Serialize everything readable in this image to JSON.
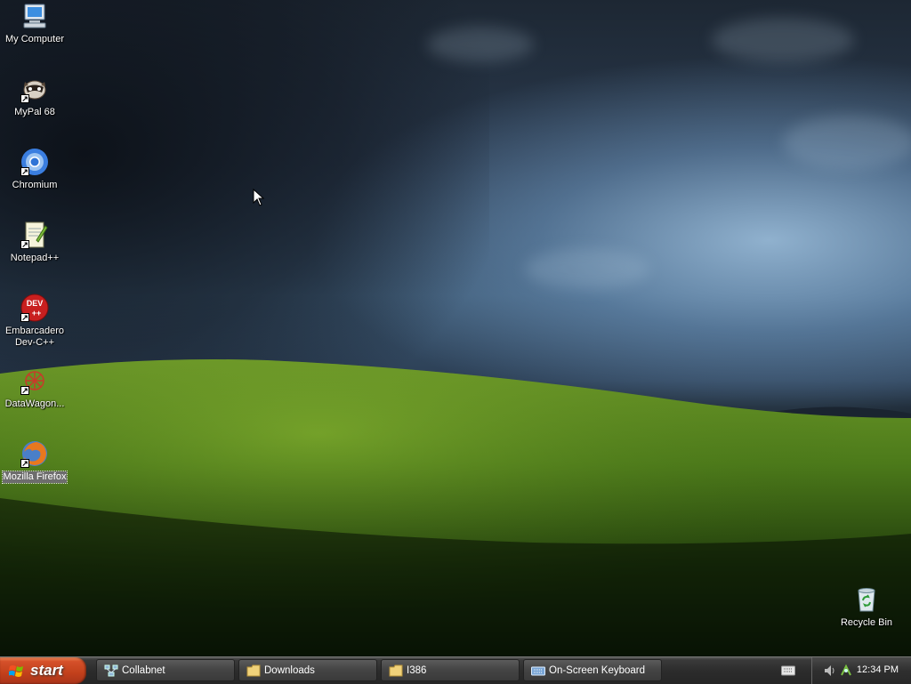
{
  "desktop": {
    "icons": [
      {
        "label": "My Computer",
        "icon": "computer-icon",
        "shortcut": false
      },
      {
        "label": "MyPal 68",
        "icon": "raccoon-icon",
        "shortcut": true
      },
      {
        "label": "Chromium",
        "icon": "chromium-icon",
        "shortcut": true
      },
      {
        "label": "Notepad++",
        "icon": "notepad-icon",
        "shortcut": true
      },
      {
        "label": "Embarcadero Dev-C++",
        "icon": "devcpp-icon",
        "shortcut": true
      },
      {
        "label": "DataWagon...",
        "icon": "datawagon-icon",
        "shortcut": true
      },
      {
        "label": "Mozilla Firefox",
        "icon": "firefox-icon",
        "shortcut": true,
        "selected": true
      }
    ],
    "recycle_bin": {
      "label": "Recycle Bin",
      "icon": "recycle-bin-icon"
    }
  },
  "taskbar": {
    "start_label": "start",
    "tasks": [
      {
        "label": "Collabnet",
        "icon": "network-icon"
      },
      {
        "label": "Downloads",
        "icon": "folder-icon"
      },
      {
        "label": "I386",
        "icon": "folder-icon"
      },
      {
        "label": "On-Screen Keyboard",
        "icon": "keyboard-icon"
      }
    ],
    "tray": {
      "clock": "12:34 PM",
      "icons": [
        "keyboard-icon",
        "speaker-icon",
        "network-icon"
      ]
    }
  },
  "colors": {
    "start": "#c2401b",
    "taskbar": "#2c2c2c",
    "grass": "#4f7a18",
    "sky": "#3b5670"
  }
}
